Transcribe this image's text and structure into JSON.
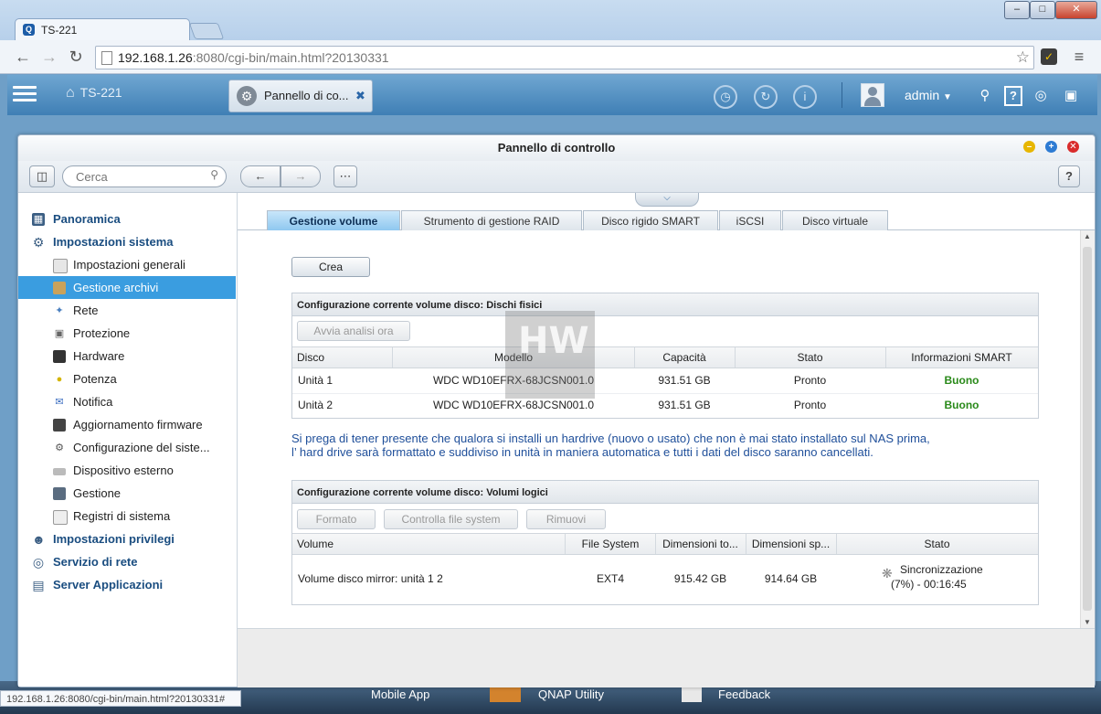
{
  "browser": {
    "tab_title": "TS-221",
    "tab_icon_letter": "Q",
    "url_host": "192.168.1.26",
    "url_rest": ":8080/cgi-bin/main.html?20130331",
    "status_url": "192.168.1.26:8080/cgi-bin/main.html?20130331#"
  },
  "qnap": {
    "home_label": "TS-221",
    "open_tab_label": "Pannello di co...",
    "user": "admin"
  },
  "window": {
    "title": "Pannello di controllo",
    "search_placeholder": "Cerca",
    "help": "?"
  },
  "sidebar": {
    "items": [
      {
        "label": "Panoramica"
      },
      {
        "label": "Impostazioni sistema"
      },
      {
        "label": "Impostazioni generali"
      },
      {
        "label": "Gestione archivi"
      },
      {
        "label": "Rete"
      },
      {
        "label": "Protezione"
      },
      {
        "label": "Hardware"
      },
      {
        "label": "Potenza"
      },
      {
        "label": "Notifica"
      },
      {
        "label": "Aggiornamento firmware"
      },
      {
        "label": "Configurazione del siste..."
      },
      {
        "label": "Dispositivo esterno"
      },
      {
        "label": "Gestione"
      },
      {
        "label": "Registri di sistema"
      },
      {
        "label": "Impostazioni privilegi"
      },
      {
        "label": "Servizio di rete"
      },
      {
        "label": "Server Applicazioni"
      }
    ]
  },
  "tabs": [
    {
      "label": "Gestione volume"
    },
    {
      "label": "Strumento di gestione RAID"
    },
    {
      "label": "Disco rigido SMART"
    },
    {
      "label": "iSCSI"
    },
    {
      "label": "Disco virtuale"
    }
  ],
  "content": {
    "create_button": "Crea",
    "physical": {
      "title": "Configurazione corrente volume disco: Dischi fisici",
      "scan_button": "Avvia analisi ora",
      "headers": [
        "Disco",
        "Modello",
        "Capacità",
        "Stato",
        "Informazioni SMART"
      ],
      "rows": [
        [
          "Unità 1",
          "WDC WD10EFRX-68JCSN001.0",
          "931.51 GB",
          "Pronto",
          "Buono"
        ],
        [
          "Unità 2",
          "WDC WD10EFRX-68JCSN001.0",
          "931.51 GB",
          "Pronto",
          "Buono"
        ]
      ]
    },
    "note_line1": "Si prega di tener presente che qualora si installi un hardrive (nuovo o usato) che non è mai stato installato sul NAS prima,",
    "note_line2": "l’  hard drive sarà formattato e suddiviso in unità in maniera automatica e tutti i dati del disco saranno cancellati.",
    "logical": {
      "title": "Configurazione corrente volume disco: Volumi logici",
      "buttons": [
        "Formato",
        "Controlla file system",
        "Rimuovi"
      ],
      "headers": [
        "Volume",
        "File System",
        "Dimensioni to...",
        "Dimensioni sp...",
        "Stato"
      ],
      "row": {
        "volume": "Volume disco mirror: unità 1 2",
        "fs": "EXT4",
        "total": "915.42 GB",
        "free": "914.64 GB",
        "status1": "Sincronizzazione",
        "status2": "(7%) - 00:16:45"
      }
    }
  },
  "taskbar": {
    "item1": "Mobile App",
    "item2": "QNAP Utility",
    "item3": "Feedback"
  },
  "colors": {
    "accent": "#3a9de0",
    "good": "#2a8a1a",
    "note": "#1f4f9a"
  }
}
